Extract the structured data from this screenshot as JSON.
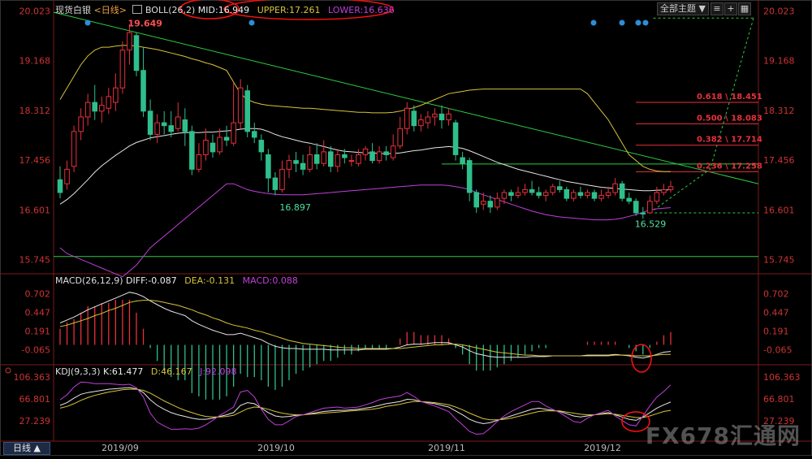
{
  "header": {
    "instrument": "现货白银",
    "period": "<日线>",
    "boll_label": "BOLL(26,2)",
    "mid": "MID:16.949",
    "upper": "UPPER:17.261",
    "lower": "LOWER:16.636",
    "topic_select": "全部主题",
    "topic_arrow": "▼"
  },
  "price_axis_ticks": [
    "20.023",
    "19.168",
    "18.312",
    "17.456",
    "16.601",
    "15.745"
  ],
  "macd_header": {
    "label": "MACD(26,12,9)",
    "diff": "DIFF:-0.087",
    "dea": "DEA:-0.131",
    "macd": "MACD:0.088"
  },
  "macd_axis_ticks": [
    "0.702",
    "0.447",
    "0.191",
    "-0.065"
  ],
  "kdj_header": {
    "label": "KDJ(9,3,3)",
    "k": "K:61.477",
    "d": "D:46.167",
    "j": "J:92.098"
  },
  "kdj_axis_ticks": [
    "106.363",
    "66.801",
    "27.239"
  ],
  "date_labels": [
    "2019/09",
    "2019/10",
    "2019/11",
    "2019/12"
  ],
  "period_button": "日线 ▲",
  "watermark": "FX678汇通网",
  "annotations": {
    "high": "19.649",
    "low1": "16.897",
    "low2": "16.529",
    "fib": [
      "0.618 \\ 18.451",
      "0.500 \\ 18.083",
      "0.382 \\ 17.714",
      "0.236 \\ 17.258"
    ]
  },
  "colors": {
    "up": "#e8313b",
    "down": "#2fbf8c",
    "mid": "#e6e6e6",
    "upper": "#d8c33a",
    "lower": "#c040d8",
    "trend": "#2ecc40",
    "fib": "#e8313b",
    "highlight_ellipse": "#ff1010"
  },
  "chart_data": {
    "type": "candlestick",
    "price_range": [
      15.6,
      20.1
    ],
    "macd_range": [
      -0.25,
      0.85
    ],
    "kdj_range": [
      -5,
      112
    ],
    "candles": [
      [
        17.12,
        16.9,
        17.35,
        16.8
      ],
      [
        17.05,
        17.3,
        17.45,
        16.95
      ],
      [
        17.35,
        17.95,
        18.05,
        17.25
      ],
      [
        17.95,
        18.2,
        18.35,
        17.8
      ],
      [
        18.2,
        18.45,
        18.6,
        18.05
      ],
      [
        18.45,
        18.3,
        18.75,
        18.15
      ],
      [
        18.3,
        18.4,
        18.55,
        18.1
      ],
      [
        18.35,
        18.55,
        18.7,
        18.25
      ],
      [
        18.45,
        18.7,
        18.95,
        18.3
      ],
      [
        18.7,
        19.35,
        19.5,
        18.6
      ],
      [
        19.35,
        19.65,
        19.8,
        19.1
      ],
      [
        19.6,
        19.0,
        19.65,
        18.9
      ],
      [
        19.0,
        18.3,
        19.4,
        18.2
      ],
      [
        18.3,
        17.9,
        18.5,
        17.8
      ],
      [
        17.9,
        18.1,
        18.25,
        17.75
      ],
      [
        18.1,
        18.05,
        18.3,
        17.9
      ],
      [
        18.05,
        17.95,
        18.3,
        17.85
      ],
      [
        18.0,
        18.2,
        18.45,
        17.95
      ],
      [
        18.15,
        17.95,
        18.35,
        17.7
      ],
      [
        17.95,
        17.3,
        18.05,
        17.2
      ],
      [
        17.3,
        17.55,
        17.75,
        17.25
      ],
      [
        17.55,
        17.8,
        18.0,
        17.45
      ],
      [
        17.75,
        17.6,
        17.9,
        17.5
      ],
      [
        17.6,
        17.85,
        18.0,
        17.55
      ],
      [
        17.85,
        17.8,
        18.05,
        17.7
      ],
      [
        17.75,
        18.1,
        18.8,
        17.7
      ],
      [
        18.1,
        18.7,
        18.85,
        18.0
      ],
      [
        18.65,
        17.95,
        18.75,
        17.85
      ],
      [
        17.95,
        17.85,
        18.1,
        17.75
      ],
      [
        17.8,
        17.6,
        17.9,
        17.45
      ],
      [
        17.55,
        17.15,
        17.65,
        16.9
      ],
      [
        17.15,
        16.95,
        17.25,
        16.85
      ],
      [
        16.95,
        17.3,
        17.45,
        16.9
      ],
      [
        17.3,
        17.45,
        17.55,
        17.15
      ],
      [
        17.45,
        17.4,
        17.6,
        17.25
      ],
      [
        17.4,
        17.3,
        17.55,
        17.2
      ],
      [
        17.3,
        17.55,
        17.7,
        17.25
      ],
      [
        17.55,
        17.4,
        17.75,
        17.3
      ],
      [
        17.4,
        17.6,
        17.8,
        17.35
      ],
      [
        17.6,
        17.35,
        17.7,
        17.25
      ],
      [
        17.35,
        17.55,
        17.65,
        17.25
      ],
      [
        17.55,
        17.5,
        17.65,
        17.4
      ],
      [
        17.45,
        17.45,
        17.55,
        17.35
      ],
      [
        17.4,
        17.55,
        17.65,
        17.35
      ],
      [
        17.55,
        17.65,
        17.7,
        17.45
      ],
      [
        17.6,
        17.45,
        17.75,
        17.4
      ],
      [
        17.45,
        17.6,
        17.7,
        17.4
      ],
      [
        17.6,
        17.55,
        17.7,
        17.45
      ],
      [
        17.5,
        17.7,
        17.9,
        17.45
      ],
      [
        17.7,
        18.0,
        18.2,
        17.65
      ],
      [
        18.0,
        18.35,
        18.45,
        17.9
      ],
      [
        18.3,
        18.05,
        18.4,
        17.95
      ],
      [
        18.05,
        18.15,
        18.25,
        17.95
      ],
      [
        18.1,
        18.2,
        18.3,
        18.0
      ],
      [
        18.2,
        18.25,
        18.35,
        18.05
      ],
      [
        18.25,
        18.15,
        18.4,
        18.0
      ],
      [
        18.15,
        18.25,
        18.35,
        18.05
      ],
      [
        18.1,
        17.55,
        18.15,
        17.45
      ],
      [
        17.5,
        17.4,
        17.6,
        17.3
      ],
      [
        17.45,
        16.9,
        17.5,
        16.75
      ],
      [
        16.9,
        16.65,
        16.95,
        16.55
      ],
      [
        16.7,
        16.75,
        16.9,
        16.6
      ],
      [
        16.75,
        16.65,
        16.85,
        16.55
      ],
      [
        16.65,
        16.8,
        16.9,
        16.6
      ],
      [
        16.8,
        16.9,
        16.95,
        16.7
      ],
      [
        16.9,
        16.85,
        16.95,
        16.75
      ],
      [
        16.85,
        16.9,
        17.0,
        16.8
      ],
      [
        16.9,
        16.95,
        17.05,
        16.85
      ],
      [
        16.95,
        16.9,
        17.1,
        16.85
      ],
      [
        16.9,
        16.85,
        17.0,
        16.8
      ],
      [
        16.85,
        16.9,
        16.95,
        16.75
      ],
      [
        16.9,
        17.0,
        17.05,
        16.85
      ],
      [
        17.0,
        16.95,
        17.1,
        16.9
      ],
      [
        16.95,
        16.8,
        17.0,
        16.75
      ],
      [
        16.8,
        16.9,
        16.95,
        16.75
      ],
      [
        16.9,
        16.85,
        17.0,
        16.8
      ],
      [
        16.85,
        16.9,
        16.95,
        16.8
      ],
      [
        16.9,
        16.8,
        16.95,
        16.75
      ],
      [
        16.8,
        16.85,
        16.95,
        16.75
      ],
      [
        16.85,
        16.9,
        17.0,
        16.8
      ],
      [
        16.9,
        17.05,
        17.15,
        16.85
      ],
      [
        17.05,
        16.8,
        17.1,
        16.75
      ],
      [
        16.8,
        16.75,
        16.9,
        16.7
      ],
      [
        16.75,
        16.55,
        16.8,
        16.5
      ],
      [
        16.55,
        16.53,
        16.65,
        16.45
      ],
      [
        16.55,
        16.75,
        16.85,
        16.53
      ],
      [
        16.75,
        16.9,
        17.0,
        16.7
      ],
      [
        16.9,
        16.95,
        17.05,
        16.85
      ],
      [
        16.95,
        17.0,
        17.1,
        16.9
      ]
    ],
    "boll_mid": [
      16.7,
      16.78,
      16.88,
      17.0,
      17.12,
      17.25,
      17.36,
      17.45,
      17.54,
      17.62,
      17.7,
      17.76,
      17.8,
      17.84,
      17.86,
      17.88,
      17.9,
      17.92,
      17.93,
      17.93,
      17.93,
      17.94,
      17.94,
      17.95,
      17.96,
      17.97,
      17.99,
      18.0,
      18.0,
      17.99,
      17.95,
      17.9,
      17.86,
      17.83,
      17.8,
      17.77,
      17.75,
      17.72,
      17.69,
      17.66,
      17.63,
      17.61,
      17.6,
      17.59,
      17.58,
      17.58,
      17.57,
      17.57,
      17.57,
      17.58,
      17.6,
      17.62,
      17.63,
      17.65,
      17.67,
      17.68,
      17.69,
      17.68,
      17.66,
      17.62,
      17.57,
      17.52,
      17.47,
      17.42,
      17.38,
      17.34,
      17.3,
      17.27,
      17.24,
      17.21,
      17.18,
      17.15,
      17.12,
      17.09,
      17.07,
      17.05,
      17.03,
      17.01,
      16.99,
      16.98,
      16.97,
      16.96,
      16.95,
      16.94,
      16.93,
      16.93,
      16.94,
      16.94,
      16.95
    ],
    "boll_upper": [
      18.5,
      18.7,
      18.9,
      19.1,
      19.25,
      19.35,
      19.4,
      19.4,
      19.42,
      19.43,
      19.43,
      19.42,
      19.4,
      19.38,
      19.36,
      19.33,
      19.3,
      19.27,
      19.24,
      19.2,
      19.17,
      19.13,
      19.1,
      19.05,
      19.0,
      18.8,
      18.6,
      18.5,
      18.45,
      18.42,
      18.4,
      18.39,
      18.38,
      18.37,
      18.36,
      18.35,
      18.35,
      18.34,
      18.33,
      18.32,
      18.31,
      18.3,
      18.29,
      18.28,
      18.28,
      18.27,
      18.27,
      18.27,
      18.28,
      18.3,
      18.33,
      18.36,
      18.4,
      18.45,
      18.5,
      18.55,
      18.6,
      18.62,
      18.64,
      18.66,
      18.67,
      18.68,
      18.68,
      18.68,
      18.68,
      18.68,
      18.68,
      18.68,
      18.68,
      18.68,
      18.68,
      18.68,
      18.68,
      18.68,
      18.68,
      18.68,
      18.6,
      18.45,
      18.3,
      18.15,
      17.95,
      17.75,
      17.55,
      17.45,
      17.35,
      17.3,
      17.27,
      17.26,
      17.26
    ],
    "boll_lower": [
      15.95,
      15.85,
      15.8,
      15.75,
      15.7,
      15.65,
      15.6,
      15.55,
      15.5,
      15.45,
      15.55,
      15.65,
      15.8,
      15.95,
      16.05,
      16.15,
      16.25,
      16.35,
      16.45,
      16.55,
      16.65,
      16.75,
      16.85,
      16.95,
      17.05,
      17.05,
      17.0,
      16.95,
      16.92,
      16.9,
      16.88,
      16.87,
      16.86,
      16.86,
      16.86,
      16.86,
      16.87,
      16.88,
      16.89,
      16.9,
      16.91,
      16.92,
      16.93,
      16.94,
      16.95,
      16.96,
      16.97,
      16.98,
      16.99,
      17.0,
      17.01,
      17.02,
      17.03,
      17.03,
      17.03,
      17.03,
      17.02,
      17.0,
      16.98,
      16.95,
      16.9,
      16.86,
      16.82,
      16.78,
      16.74,
      16.7,
      16.66,
      16.62,
      16.58,
      16.55,
      16.52,
      16.5,
      16.48,
      16.47,
      16.46,
      16.45,
      16.44,
      16.43,
      16.43,
      16.43,
      16.44,
      16.46,
      16.49,
      16.52,
      16.56,
      16.6,
      16.62,
      16.63,
      16.64
    ],
    "macd_diff": [
      0.3,
      0.34,
      0.38,
      0.43,
      0.48,
      0.52,
      0.56,
      0.6,
      0.64,
      0.68,
      0.72,
      0.7,
      0.66,
      0.6,
      0.55,
      0.5,
      0.46,
      0.43,
      0.4,
      0.33,
      0.28,
      0.24,
      0.2,
      0.17,
      0.14,
      0.14,
      0.16,
      0.13,
      0.1,
      0.07,
      0.02,
      -0.02,
      -0.04,
      -0.05,
      -0.05,
      -0.06,
      -0.06,
      -0.06,
      -0.06,
      -0.07,
      -0.07,
      -0.07,
      -0.07,
      -0.07,
      -0.06,
      -0.06,
      -0.06,
      -0.06,
      -0.05,
      -0.03,
      0.0,
      0.01,
      0.01,
      0.02,
      0.03,
      0.03,
      0.03,
      0.0,
      -0.03,
      -0.08,
      -0.12,
      -0.14,
      -0.16,
      -0.17,
      -0.17,
      -0.17,
      -0.17,
      -0.17,
      -0.16,
      -0.16,
      -0.16,
      -0.15,
      -0.15,
      -0.15,
      -0.15,
      -0.15,
      -0.14,
      -0.14,
      -0.14,
      -0.14,
      -0.13,
      -0.14,
      -0.15,
      -0.17,
      -0.18,
      -0.16,
      -0.13,
      -0.1,
      -0.09
    ],
    "macd_dea": [
      0.25,
      0.27,
      0.3,
      0.33,
      0.36,
      0.4,
      0.43,
      0.47,
      0.5,
      0.54,
      0.58,
      0.6,
      0.61,
      0.61,
      0.6,
      0.58,
      0.56,
      0.54,
      0.51,
      0.48,
      0.44,
      0.41,
      0.37,
      0.34,
      0.3,
      0.27,
      0.25,
      0.23,
      0.2,
      0.18,
      0.15,
      0.12,
      0.09,
      0.06,
      0.04,
      0.02,
      0.01,
      0.0,
      -0.01,
      -0.02,
      -0.03,
      -0.04,
      -0.04,
      -0.05,
      -0.05,
      -0.05,
      -0.05,
      -0.05,
      -0.05,
      -0.05,
      -0.04,
      -0.03,
      -0.02,
      -0.01,
      0.0,
      0.0,
      0.01,
      0.01,
      0.0,
      -0.02,
      -0.04,
      -0.06,
      -0.08,
      -0.1,
      -0.11,
      -0.12,
      -0.13,
      -0.14,
      -0.14,
      -0.15,
      -0.15,
      -0.15,
      -0.15,
      -0.15,
      -0.15,
      -0.15,
      -0.15,
      -0.15,
      -0.15,
      -0.15,
      -0.14,
      -0.14,
      -0.14,
      -0.15,
      -0.15,
      -0.15,
      -0.14,
      -0.13,
      -0.13
    ],
    "kdj_k": [
      55,
      60,
      68,
      75,
      78,
      80,
      82,
      84,
      85,
      86,
      87,
      85,
      78,
      65,
      55,
      48,
      42,
      38,
      35,
      32,
      30,
      30,
      32,
      35,
      38,
      42,
      55,
      60,
      58,
      50,
      42,
      36,
      34,
      35,
      37,
      38,
      40,
      42,
      44,
      45,
      46,
      46,
      47,
      48,
      50,
      52,
      55,
      58,
      60,
      62,
      66,
      65,
      62,
      60,
      58,
      55,
      52,
      45,
      38,
      30,
      25,
      22,
      24,
      28,
      32,
      36,
      40,
      44,
      48,
      50,
      48,
      46,
      44,
      40,
      36,
      34,
      36,
      38,
      40,
      42,
      38,
      34,
      30,
      28,
      34,
      42,
      50,
      56,
      61
    ],
    "kdj_d": [
      50,
      53,
      58,
      64,
      69,
      73,
      76,
      79,
      81,
      83,
      84,
      84,
      82,
      77,
      70,
      63,
      57,
      51,
      46,
      42,
      38,
      35,
      34,
      34,
      35,
      37,
      43,
      49,
      52,
      51,
      48,
      44,
      41,
      39,
      38,
      38,
      39,
      40,
      41,
      42,
      43,
      44,
      45,
      46,
      47,
      48,
      50,
      53,
      55,
      57,
      60,
      62,
      62,
      61,
      60,
      58,
      56,
      52,
      47,
      41,
      36,
      31,
      29,
      29,
      30,
      32,
      35,
      38,
      41,
      44,
      45,
      45,
      45,
      43,
      41,
      39,
      38,
      38,
      39,
      40,
      39,
      37,
      35,
      33,
      33,
      36,
      40,
      44,
      46
    ],
    "kdj_j": [
      65,
      74,
      88,
      97,
      96,
      94,
      94,
      94,
      93,
      92,
      93,
      87,
      70,
      41,
      25,
      18,
      12,
      12,
      13,
      12,
      14,
      20,
      28,
      37,
      44,
      52,
      79,
      82,
      70,
      48,
      30,
      20,
      20,
      27,
      35,
      38,
      42,
      46,
      50,
      51,
      52,
      50,
      51,
      52,
      56,
      60,
      65,
      68,
      70,
      72,
      78,
      71,
      62,
      58,
      54,
      49,
      44,
      31,
      20,
      8,
      3,
      4,
      14,
      26,
      36,
      44,
      50,
      56,
      62,
      62,
      54,
      48,
      42,
      34,
      26,
      24,
      32,
      38,
      42,
      46,
      36,
      28,
      20,
      18,
      36,
      54,
      70,
      80,
      92
    ]
  }
}
